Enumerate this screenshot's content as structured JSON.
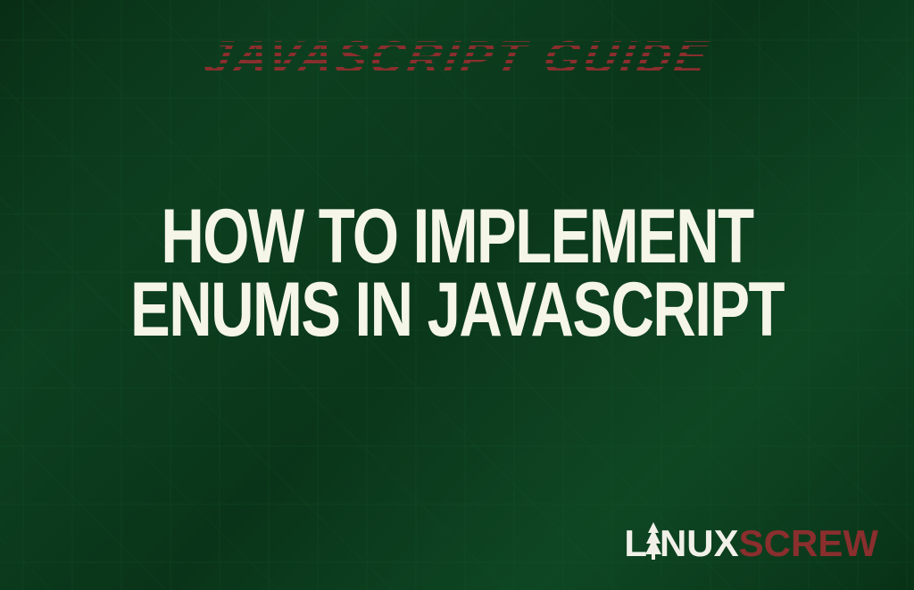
{
  "subtitle": "JAVASCRIPT GUIDE",
  "mainTitle": {
    "line1": "HOW TO IMPLEMENT",
    "line2": "ENUMS IN JAVASCRIPT"
  },
  "logo": {
    "part1": "L",
    "part2": "NUX",
    "part3": "SCREW"
  },
  "colors": {
    "accent": "#8a2e2e",
    "text": "#f5f5e8",
    "background": "#0f4522"
  }
}
